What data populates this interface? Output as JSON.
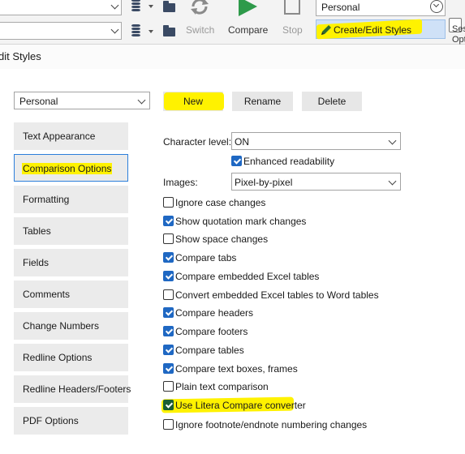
{
  "ribbon": {
    "style_combo_value": "Personal",
    "buttons": {
      "compare": "Compare",
      "stop": "Stop",
      "switch": "Switch",
      "create_edit_styles": "Create/Edit Styles",
      "session_partial": "Ses",
      "session_partial2": "Opt"
    },
    "colors": {
      "compare_green": "#2e9a4a",
      "highlight": "#fff200"
    }
  },
  "dialog": {
    "title": "dit Styles",
    "style_select_value": "Personal",
    "new_button": "New",
    "rename_button": "Rename",
    "delete_button": "Delete"
  },
  "categories": [
    "Text Appearance",
    "Comparison Options",
    "Formatting",
    "Tables",
    "Fields",
    "Comments",
    "Change Numbers",
    "Redline Options",
    "Redline Headers/Footers",
    "PDF Options"
  ],
  "selected_category": "Comparison Options",
  "options": {
    "character_level_label": "Character level:",
    "character_level_value": "ON",
    "enhanced_readability": {
      "label": "Enhanced readability",
      "checked": true
    },
    "images_label": "Images:",
    "images_value": "Pixel-by-pixel",
    "checkboxes": [
      {
        "label": "Ignore case changes",
        "checked": false
      },
      {
        "label": "Show quotation mark changes",
        "checked": true
      },
      {
        "label": "Show space changes",
        "checked": false
      },
      {
        "label": "Compare tabs",
        "checked": true
      },
      {
        "label": "Compare embedded Excel tables",
        "checked": true
      },
      {
        "label": "Convert embedded Excel tables to Word tables",
        "checked": false
      },
      {
        "label": "Compare headers",
        "checked": true
      },
      {
        "label": "Compare footers",
        "checked": true
      },
      {
        "label": "Compare tables",
        "checked": true
      },
      {
        "label": "Compare text boxes, frames",
        "checked": true
      },
      {
        "label": "Plain text comparison",
        "checked": false
      },
      {
        "label": "Use Litera Compare converter",
        "checked": true
      },
      {
        "label": "Ignore footnote/endnote numbering changes",
        "checked": false
      }
    ]
  }
}
